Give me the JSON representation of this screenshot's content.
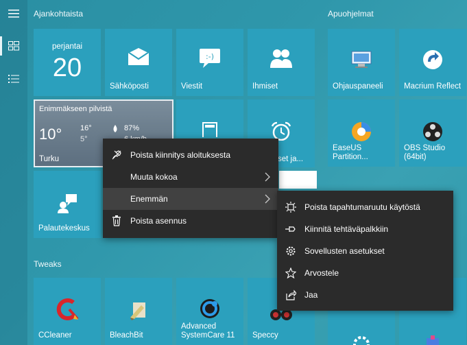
{
  "groups": {
    "ajankohtaista": "Ajankohtaista",
    "apuohjelmat": "Apuohjelmat",
    "tweaks": "Tweaks"
  },
  "calendar": {
    "weekday": "perjantai",
    "day": "20"
  },
  "tiles": {
    "sahkoposti": "Sähköposti",
    "viestit": "Viestit",
    "ihmiset": "Ihmiset",
    "ohjauspaneeli": "Ohjauspaneeli",
    "macrium": "Macrium Reflect",
    "easeus": "EaseUS Partition...",
    "obs": "OBS Studio (64bit)",
    "palautekeskus": "Palautekeskus",
    "alarms_partial": "set ja...",
    "ccleaner": "CCleaner",
    "bleachbit": "BleachBit",
    "advanced": "Advanced SystemCare 11",
    "speccy": "Speccy"
  },
  "weather": {
    "condition": "Enimmäkseen pilvistä",
    "temp": "10°",
    "high": "16°",
    "low": "5°",
    "humidity": "87%",
    "wind": "6 km/h",
    "city": "Turku"
  },
  "context_menu": {
    "items": [
      {
        "label": "Poista kiinnitys aloituksesta",
        "icon": "unpin-icon"
      },
      {
        "label": "Muuta kokoa",
        "icon": "",
        "submenu": true
      },
      {
        "label": "Enemmän",
        "icon": "",
        "submenu": true,
        "highlighted": true
      },
      {
        "label": "Poista asennus",
        "icon": "trash-icon"
      }
    ]
  },
  "submenu": {
    "items": [
      {
        "label": "Poista tapahtumaruutu käytöstä",
        "icon": "live-tile-icon"
      },
      {
        "label": "Kiinnitä tehtäväpalkkiin",
        "icon": "pin-icon"
      },
      {
        "label": "Sovellusten asetukset",
        "icon": "gear-icon"
      },
      {
        "label": "Arvostele",
        "icon": "star-icon"
      },
      {
        "label": "Jaa",
        "icon": "share-icon"
      }
    ]
  },
  "colors": {
    "tile": "#2ba0bd",
    "menu_bg": "#2b2b2b",
    "menu_highlight": "#414141"
  }
}
